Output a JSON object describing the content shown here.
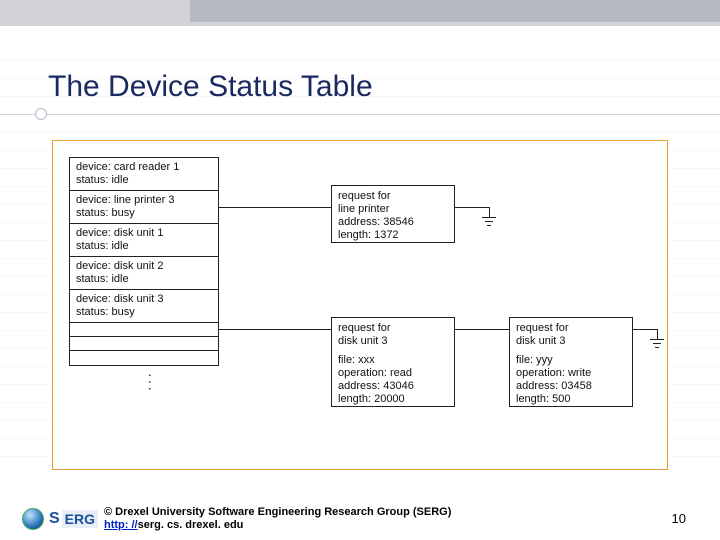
{
  "slide": {
    "title": "The Device Status Table",
    "page_number": "10"
  },
  "devices": [
    {
      "device": "device: card reader 1",
      "status": "status: idle"
    },
    {
      "device": "device: line printer 3",
      "status": "status: busy"
    },
    {
      "device": "device: disk unit 1",
      "status": "status: idle"
    },
    {
      "device": "device: disk unit 2",
      "status": "status: idle"
    },
    {
      "device": "device: disk unit 3",
      "status": "status: busy"
    }
  ],
  "requests": {
    "r1": {
      "l1": "request for",
      "l2": "line printer",
      "l3": "address: 38546",
      "l4": "length: 1372"
    },
    "r2": {
      "l1": "request for",
      "l2": "disk unit 3",
      "l3": "",
      "l4": "file: xxx",
      "l5": "operation: read",
      "l6": "address: 43046",
      "l7": "length: 20000"
    },
    "r3": {
      "l1": "request for",
      "l2": "disk unit 3",
      "l3": "",
      "l4": "file: yyy",
      "l5": "operation: write",
      "l6": "address: 03458",
      "l7": "length: 500"
    }
  },
  "footer": {
    "copyright": "© Drexel University Software Engineering Research Group (SERG)",
    "url_prefix": "http: //",
    "url_rest": "serg. cs. drexel. edu",
    "logo_s": "S",
    "logo_erg": "ERG"
  }
}
